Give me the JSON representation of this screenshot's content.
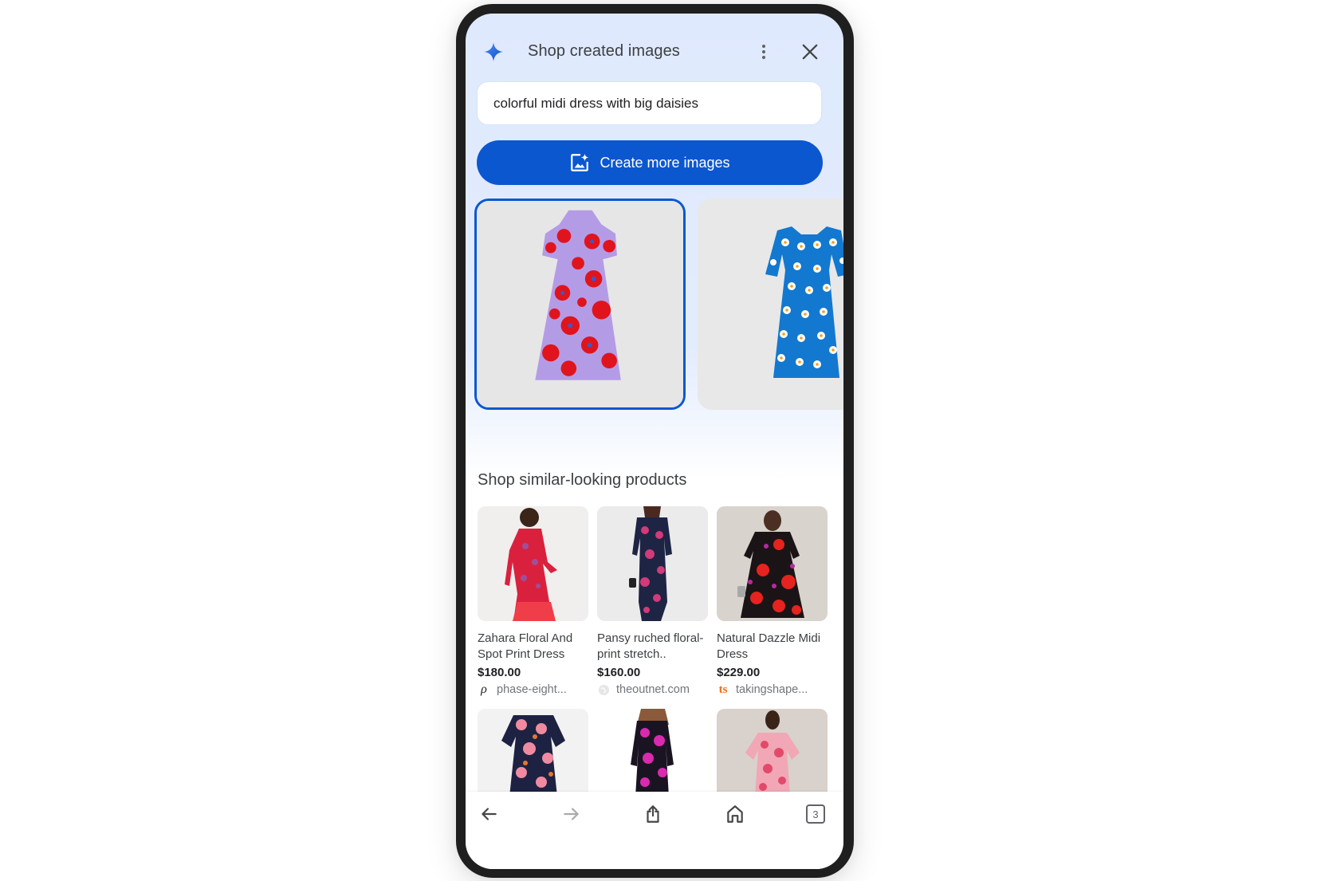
{
  "header": {
    "title": "Shop created images",
    "icons": {
      "logo": "sparkle-icon",
      "menu": "more-vert-icon",
      "close": "close-icon"
    }
  },
  "prompt": {
    "value": "colorful midi dress with big daisies"
  },
  "create_button": {
    "label": "Create more images",
    "icon": "add-photo-sparkle-icon"
  },
  "generated_images": [
    {
      "description": "Lavender pleated midi dress with large red poppy print",
      "selected": true
    },
    {
      "description": "Blue midi dress with white daisy print",
      "selected": false
    }
  ],
  "similar_products": {
    "title": "Shop similar-looking products",
    "items": [
      {
        "name": "Zahara Floral And Spot Print Dress",
        "price": "$180.00",
        "site": "phase-eight...",
        "site_icon": "phase-eight-logo"
      },
      {
        "name": "Pansy ruched floral-print stretch..",
        "price": "$160.00",
        "site": "theoutnet.com",
        "site_icon": "globe-icon"
      },
      {
        "name": "Natural Dazzle Midi Dress",
        "price": "$229.00",
        "site": "takingshape...",
        "site_icon": "ts-logo"
      },
      {
        "name": "",
        "price": "",
        "site": "",
        "site_icon": ""
      },
      {
        "name": "",
        "price": "",
        "site": "",
        "site_icon": ""
      },
      {
        "name": "",
        "price": "",
        "site": "",
        "site_icon": ""
      }
    ]
  },
  "navbar": {
    "back": "back-arrow-icon",
    "forward": "forward-arrow-icon",
    "share": "share-icon",
    "home": "home-icon",
    "tab_count": "3"
  },
  "colors": {
    "accent": "#0b57d0",
    "background_top": "#dfe9fd",
    "ts_logo": "#f26b1d"
  }
}
